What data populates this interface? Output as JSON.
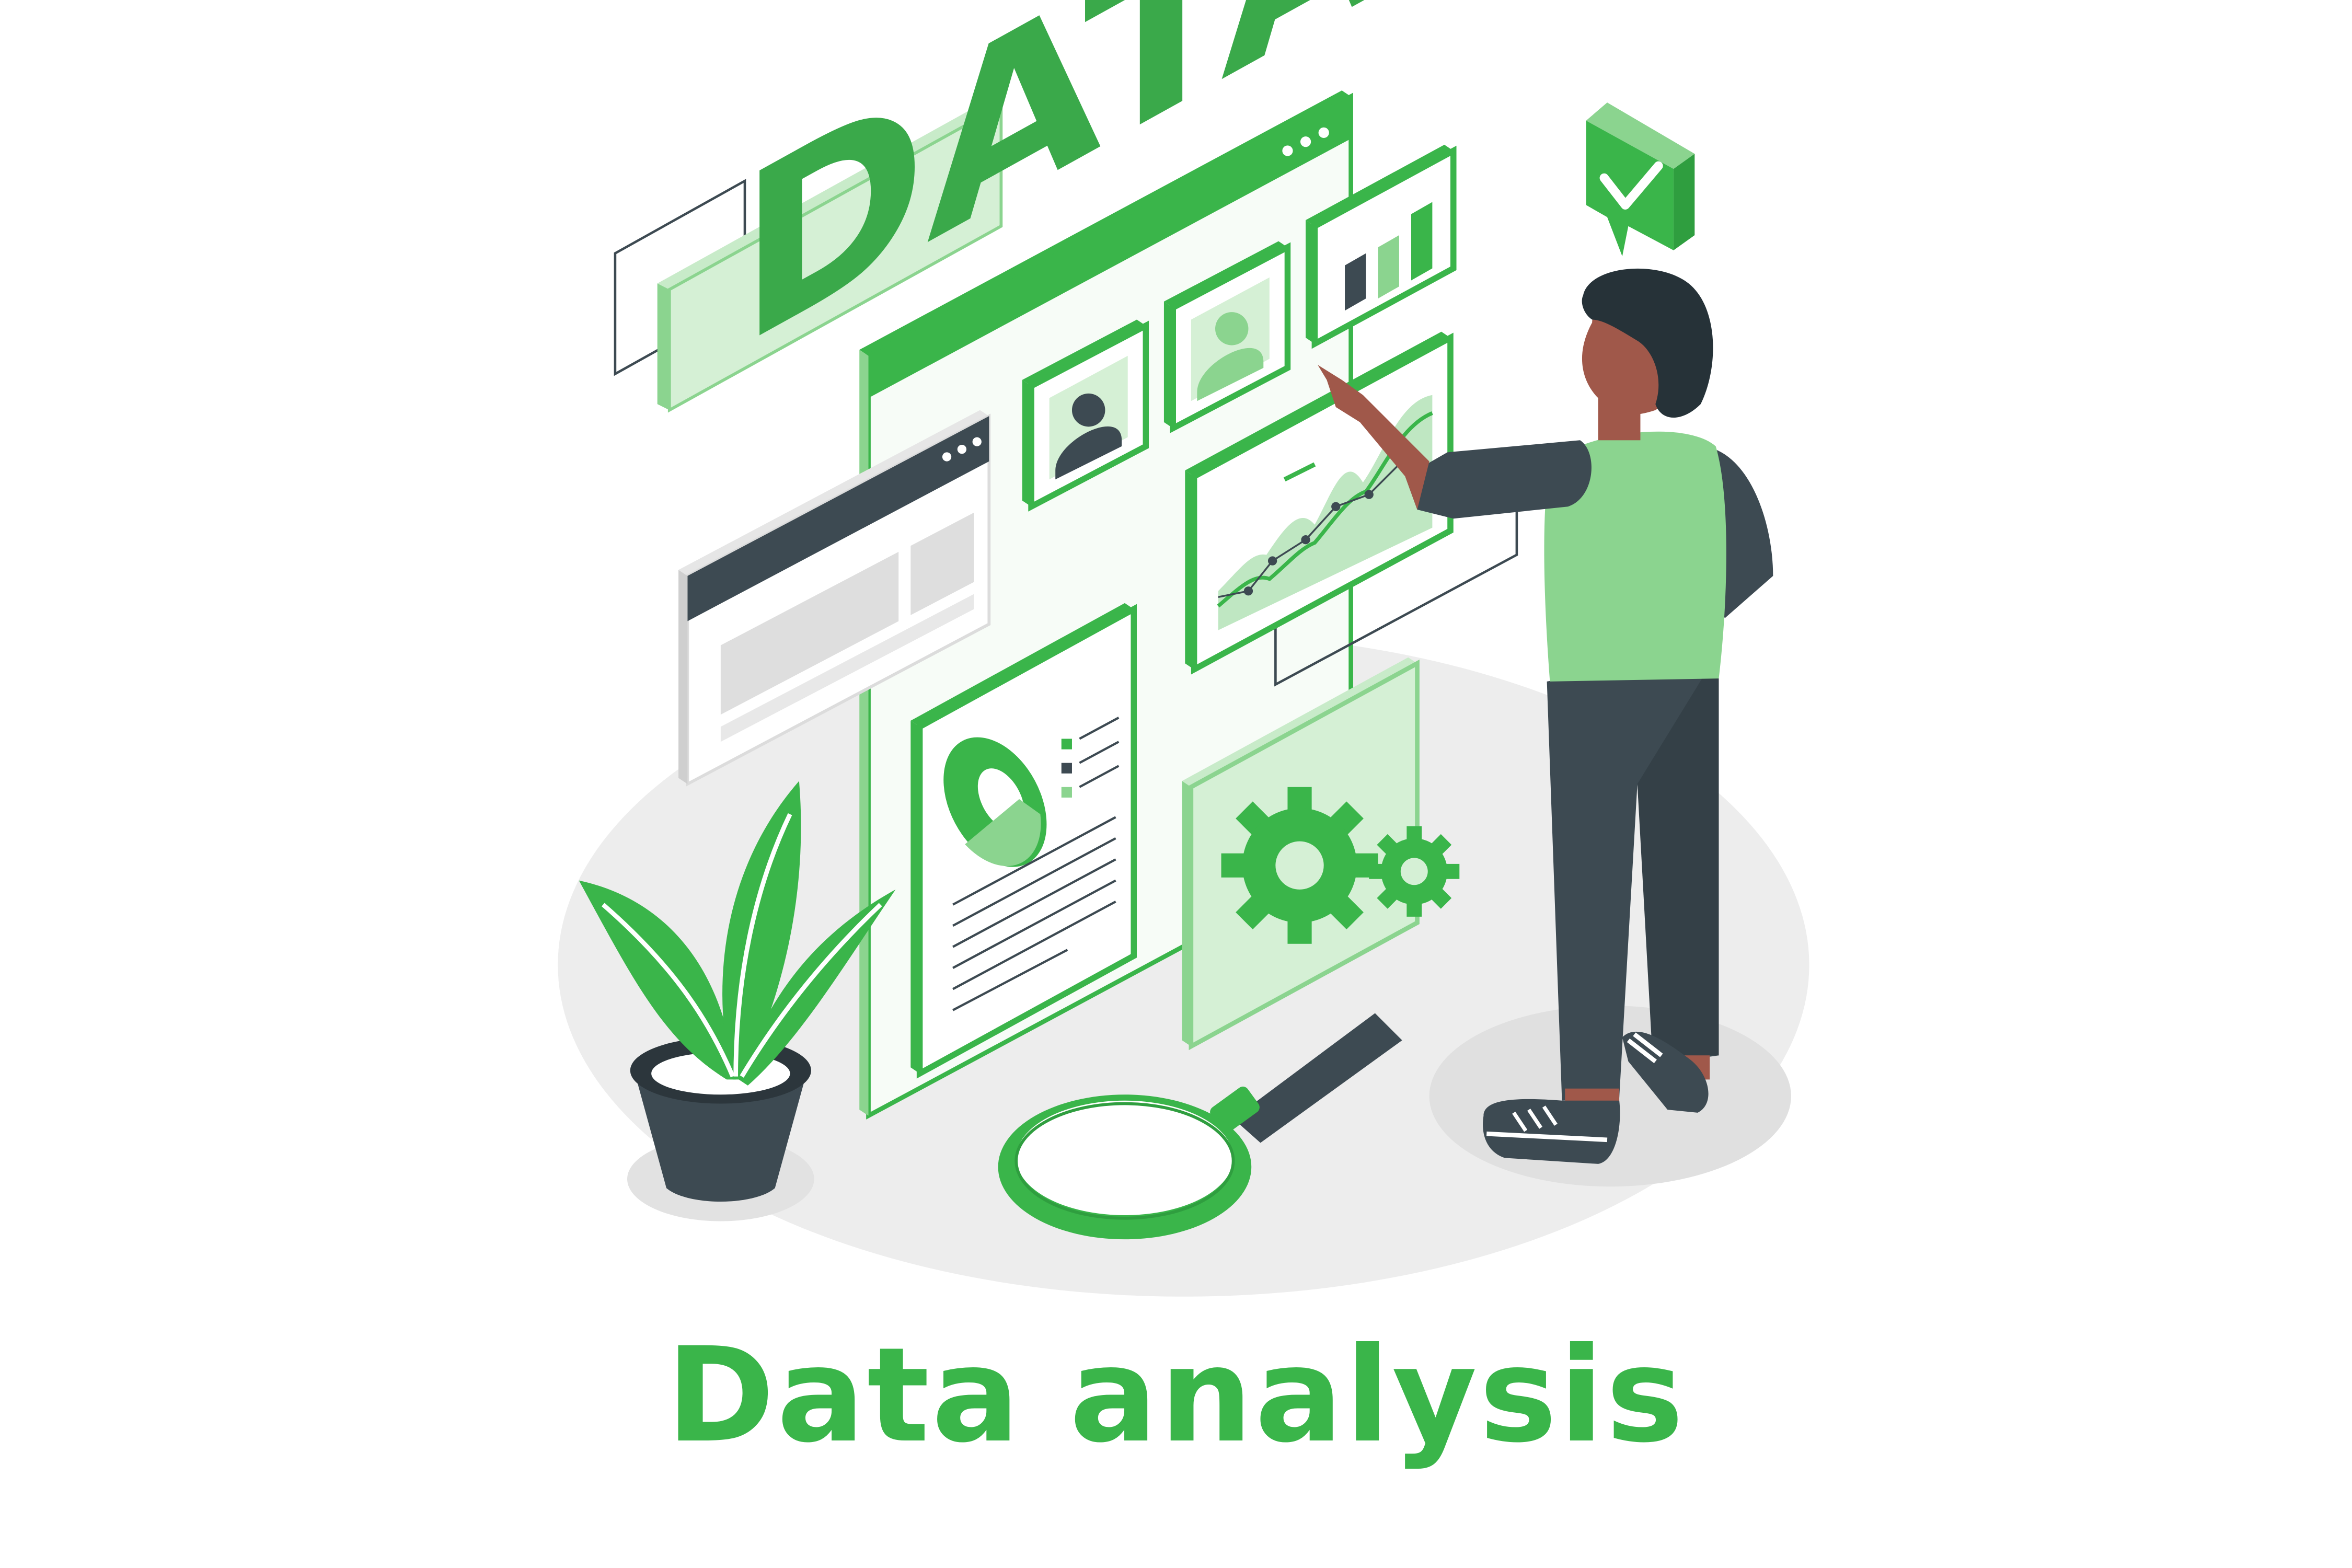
{
  "caption": "Data analysis",
  "data_tag": "DATA",
  "colors": {
    "accent_green": "#3ab54a",
    "light_green": "#8bd48f",
    "pale_green": "#d5f0d5",
    "dark_slate": "#3d4a52",
    "skin": "#a0584a",
    "shadow_gray": "#ededed"
  },
  "icons": [
    "data-tag-icon",
    "browser-window-icon",
    "user-profile-icon",
    "bar-chart-icon",
    "line-chart-icon",
    "report-document-icon",
    "pie-chart-icon",
    "gear-icon",
    "magnifying-glass-icon",
    "check-badge-icon",
    "plant-icon",
    "person-icon"
  ]
}
